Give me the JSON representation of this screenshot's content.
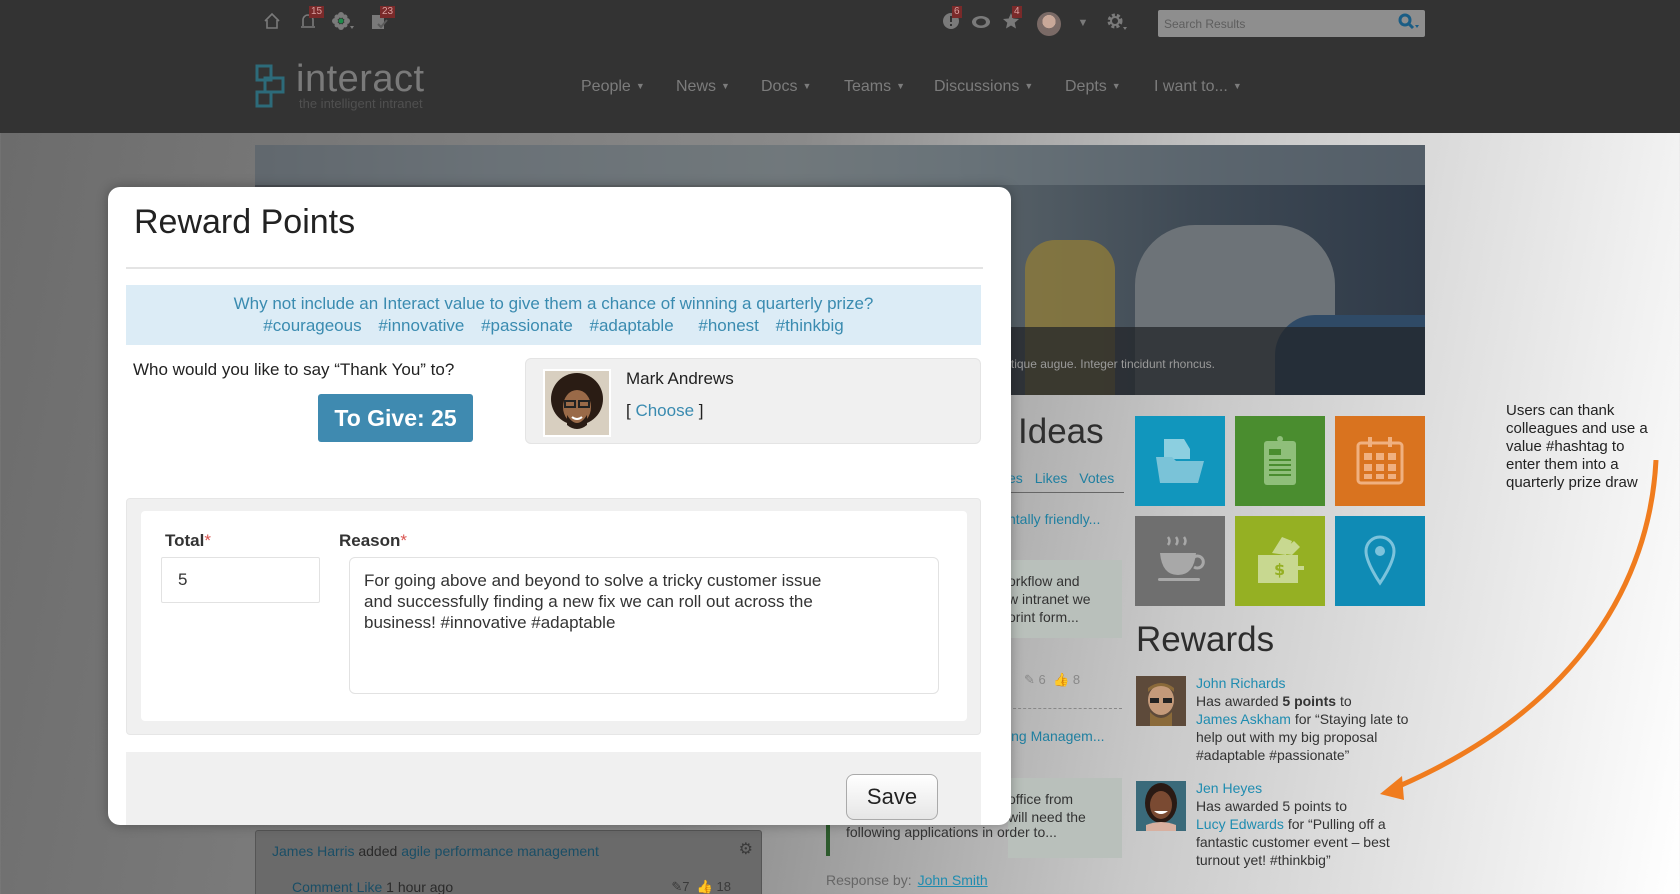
{
  "topbar": {
    "icons": [
      {
        "name": "home-icon"
      },
      {
        "name": "bell-icon",
        "badge": "15"
      },
      {
        "name": "flower-icon"
      },
      {
        "name": "clipboard-check-icon",
        "badge": "23"
      }
    ],
    "right_icons": [
      {
        "name": "alert-icon",
        "badge": "6"
      },
      {
        "name": "eye-icon"
      },
      {
        "name": "star-icon",
        "badge": "4"
      }
    ],
    "search_placeholder": "Search Results"
  },
  "header": {
    "logo_text": "interact",
    "logo_tagline": "the intelligent intranet",
    "nav": [
      {
        "label": "People"
      },
      {
        "label": "News"
      },
      {
        "label": "Docs"
      },
      {
        "label": "Teams"
      },
      {
        "label": "Discussions"
      },
      {
        "label": "Depts"
      },
      {
        "label": "I want to..."
      }
    ]
  },
  "background": {
    "hero_caption": "tique augue. Integer tincidunt rhoncus.",
    "ideas": {
      "title": "Ideas",
      "tabs": [
        "es",
        "Likes",
        "Votes"
      ],
      "link1": "ntally friendly...",
      "box1": [
        "orkflow and",
        "w intranet we",
        "orint form..."
      ],
      "stats": {
        "comments": "6",
        "likes": "8"
      },
      "link2": "ing Managem...",
      "box2": [
        "office from",
        "will need the"
      ]
    },
    "tiles_colors": [
      "#1196bd",
      "#4a8d2f",
      "#d9731f",
      "#6f6f6f",
      "#95b023",
      "#0f8bb5"
    ],
    "rewards": {
      "title": "Rewards",
      "items": [
        {
          "giver": "John Richards",
          "prefix": "Has awarded ",
          "points": "5 points",
          "to_word": " to",
          "receiver": "James Askham",
          "reason": " for “Staying late to help out with my big proposal #adaptable #passionate”"
        },
        {
          "giver": "Jen Heyes",
          "prefix": "Has awarded 5 points to",
          "receiver": "Lucy Edwards",
          "reason": " for “Pulling off a fantastic customer event – best turnout yet! #thinkbig”"
        }
      ]
    },
    "activity": {
      "actor": "James Harris",
      "verb": " added ",
      "object": "agile performance management",
      "actions": "Comment Like",
      "time": " 1 hour ago",
      "comments": "7",
      "likes": "18"
    },
    "app_text": "following applications in order to...",
    "response_label": "Response by:",
    "response_name": "John Smith",
    "annotation": "Users can thank colleagues and use a value #hashtag to enter them into a quarterly prize draw"
  },
  "modal": {
    "title": "Reward Points",
    "hint_line1": "Why not include an Interact value to give them a chance of winning a quarterly prize?",
    "hashtags": [
      "#courageous",
      "#innovative",
      "#passionate",
      "#adaptable",
      "#honest",
      "#thinkbig"
    ],
    "thank_label": "Who would you like to say “Thank You” to?",
    "to_give": "To Give: 25",
    "recipient_name": "Mark Andrews",
    "choose_open": "[ ",
    "choose_label": "Choose",
    "choose_close": " ]",
    "total_label": "Total",
    "reason_label": "Reason",
    "required_mark": "*",
    "total_value": "5",
    "reason_value": "For going above and beyond to solve a tricky customer issue\nand successfully finding a new fix we can roll out across the\nbusiness! #innovative #adaptable",
    "save_label": "Save"
  }
}
